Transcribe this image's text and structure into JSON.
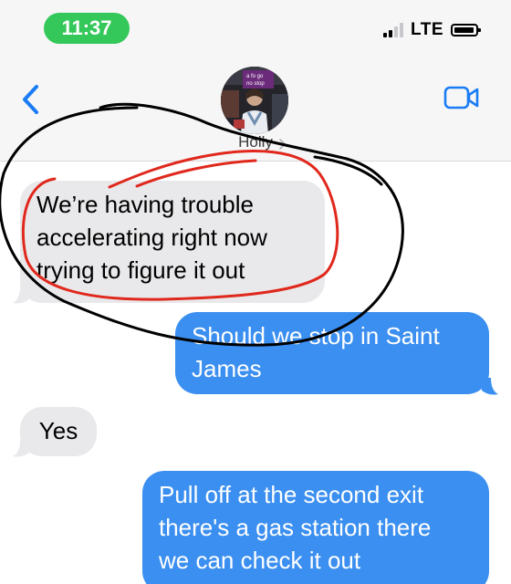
{
  "status_bar": {
    "time": "11:37",
    "network": "LTE",
    "colors": {
      "time_pill": "#34c759"
    }
  },
  "nav": {
    "back_icon": "chevron-left-icon",
    "video_icon": "video-camera-icon",
    "contact_name": "Holly",
    "avatar_sign_text": "a fo go\nno stop"
  },
  "messages": [
    {
      "direction": "incoming",
      "text": "We’re having trouble\naccelerating right now\ntrying to figure it out"
    },
    {
      "direction": "outgoing",
      "text": "Should we stop in Saint\nJames"
    },
    {
      "direction": "incoming",
      "text": "Yes"
    },
    {
      "direction": "outgoing",
      "text": "Pull off at the second exit\nthere's a gas station there\nwe can check it out"
    }
  ],
  "colors": {
    "incoming_bubble": "#e9e9eb",
    "outgoing_bubble": "#3b8ff0",
    "accent": "#1a7cf5",
    "annotation_red": "#e0281c",
    "annotation_black": "#000000"
  }
}
